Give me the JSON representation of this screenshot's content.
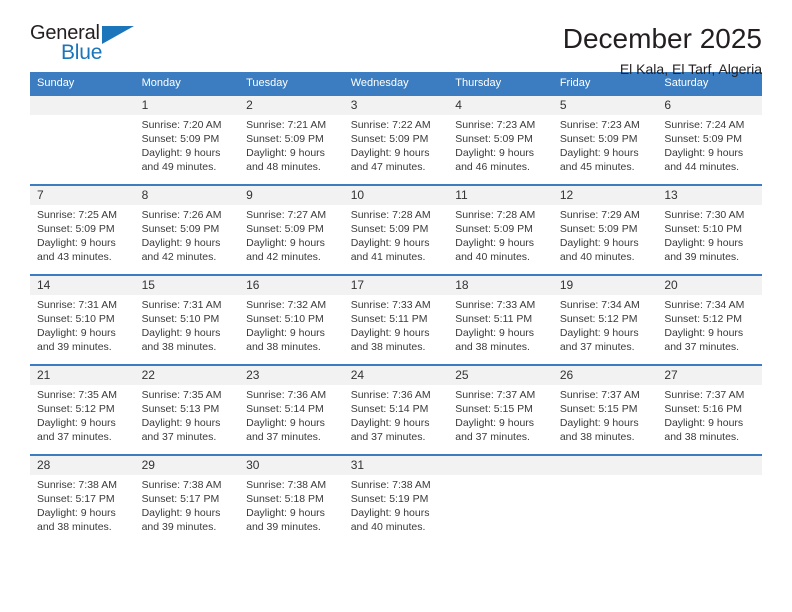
{
  "brand": {
    "name_dark": "General",
    "name_blue": "Blue",
    "accent_color": "#1b75bb"
  },
  "header": {
    "month_year": "December 2025",
    "location": "El Kala, El Tarf, Algeria"
  },
  "theme": {
    "header_row_bg": "#3b7dc0",
    "daynum_bg": "#f2f2f2",
    "text_color": "#333333"
  },
  "weekdays": [
    "Sunday",
    "Monday",
    "Tuesday",
    "Wednesday",
    "Thursday",
    "Friday",
    "Saturday"
  ],
  "labels": {
    "sunrise_prefix": "Sunrise:",
    "sunset_prefix": "Sunset:",
    "daylight_prefix": "Daylight:"
  },
  "weeks": [
    [
      {
        "day": "",
        "empty": true
      },
      {
        "day": "1",
        "line1": "Sunrise: 7:20 AM",
        "line2": "Sunset: 5:09 PM",
        "line3": "Daylight: 9 hours",
        "line4": "and 49 minutes."
      },
      {
        "day": "2",
        "line1": "Sunrise: 7:21 AM",
        "line2": "Sunset: 5:09 PM",
        "line3": "Daylight: 9 hours",
        "line4": "and 48 minutes."
      },
      {
        "day": "3",
        "line1": "Sunrise: 7:22 AM",
        "line2": "Sunset: 5:09 PM",
        "line3": "Daylight: 9 hours",
        "line4": "and 47 minutes."
      },
      {
        "day": "4",
        "line1": "Sunrise: 7:23 AM",
        "line2": "Sunset: 5:09 PM",
        "line3": "Daylight: 9 hours",
        "line4": "and 46 minutes."
      },
      {
        "day": "5",
        "line1": "Sunrise: 7:23 AM",
        "line2": "Sunset: 5:09 PM",
        "line3": "Daylight: 9 hours",
        "line4": "and 45 minutes."
      },
      {
        "day": "6",
        "line1": "Sunrise: 7:24 AM",
        "line2": "Sunset: 5:09 PM",
        "line3": "Daylight: 9 hours",
        "line4": "and 44 minutes."
      }
    ],
    [
      {
        "day": "7",
        "line1": "Sunrise: 7:25 AM",
        "line2": "Sunset: 5:09 PM",
        "line3": "Daylight: 9 hours",
        "line4": "and 43 minutes."
      },
      {
        "day": "8",
        "line1": "Sunrise: 7:26 AM",
        "line2": "Sunset: 5:09 PM",
        "line3": "Daylight: 9 hours",
        "line4": "and 42 minutes."
      },
      {
        "day": "9",
        "line1": "Sunrise: 7:27 AM",
        "line2": "Sunset: 5:09 PM",
        "line3": "Daylight: 9 hours",
        "line4": "and 42 minutes."
      },
      {
        "day": "10",
        "line1": "Sunrise: 7:28 AM",
        "line2": "Sunset: 5:09 PM",
        "line3": "Daylight: 9 hours",
        "line4": "and 41 minutes."
      },
      {
        "day": "11",
        "line1": "Sunrise: 7:28 AM",
        "line2": "Sunset: 5:09 PM",
        "line3": "Daylight: 9 hours",
        "line4": "and 40 minutes."
      },
      {
        "day": "12",
        "line1": "Sunrise: 7:29 AM",
        "line2": "Sunset: 5:09 PM",
        "line3": "Daylight: 9 hours",
        "line4": "and 40 minutes."
      },
      {
        "day": "13",
        "line1": "Sunrise: 7:30 AM",
        "line2": "Sunset: 5:10 PM",
        "line3": "Daylight: 9 hours",
        "line4": "and 39 minutes."
      }
    ],
    [
      {
        "day": "14",
        "line1": "Sunrise: 7:31 AM",
        "line2": "Sunset: 5:10 PM",
        "line3": "Daylight: 9 hours",
        "line4": "and 39 minutes."
      },
      {
        "day": "15",
        "line1": "Sunrise: 7:31 AM",
        "line2": "Sunset: 5:10 PM",
        "line3": "Daylight: 9 hours",
        "line4": "and 38 minutes."
      },
      {
        "day": "16",
        "line1": "Sunrise: 7:32 AM",
        "line2": "Sunset: 5:10 PM",
        "line3": "Daylight: 9 hours",
        "line4": "and 38 minutes."
      },
      {
        "day": "17",
        "line1": "Sunrise: 7:33 AM",
        "line2": "Sunset: 5:11 PM",
        "line3": "Daylight: 9 hours",
        "line4": "and 38 minutes."
      },
      {
        "day": "18",
        "line1": "Sunrise: 7:33 AM",
        "line2": "Sunset: 5:11 PM",
        "line3": "Daylight: 9 hours",
        "line4": "and 38 minutes."
      },
      {
        "day": "19",
        "line1": "Sunrise: 7:34 AM",
        "line2": "Sunset: 5:12 PM",
        "line3": "Daylight: 9 hours",
        "line4": "and 37 minutes."
      },
      {
        "day": "20",
        "line1": "Sunrise: 7:34 AM",
        "line2": "Sunset: 5:12 PM",
        "line3": "Daylight: 9 hours",
        "line4": "and 37 minutes."
      }
    ],
    [
      {
        "day": "21",
        "line1": "Sunrise: 7:35 AM",
        "line2": "Sunset: 5:12 PM",
        "line3": "Daylight: 9 hours",
        "line4": "and 37 minutes."
      },
      {
        "day": "22",
        "line1": "Sunrise: 7:35 AM",
        "line2": "Sunset: 5:13 PM",
        "line3": "Daylight: 9 hours",
        "line4": "and 37 minutes."
      },
      {
        "day": "23",
        "line1": "Sunrise: 7:36 AM",
        "line2": "Sunset: 5:14 PM",
        "line3": "Daylight: 9 hours",
        "line4": "and 37 minutes."
      },
      {
        "day": "24",
        "line1": "Sunrise: 7:36 AM",
        "line2": "Sunset: 5:14 PM",
        "line3": "Daylight: 9 hours",
        "line4": "and 37 minutes."
      },
      {
        "day": "25",
        "line1": "Sunrise: 7:37 AM",
        "line2": "Sunset: 5:15 PM",
        "line3": "Daylight: 9 hours",
        "line4": "and 37 minutes."
      },
      {
        "day": "26",
        "line1": "Sunrise: 7:37 AM",
        "line2": "Sunset: 5:15 PM",
        "line3": "Daylight: 9 hours",
        "line4": "and 38 minutes."
      },
      {
        "day": "27",
        "line1": "Sunrise: 7:37 AM",
        "line2": "Sunset: 5:16 PM",
        "line3": "Daylight: 9 hours",
        "line4": "and 38 minutes."
      }
    ],
    [
      {
        "day": "28",
        "line1": "Sunrise: 7:38 AM",
        "line2": "Sunset: 5:17 PM",
        "line3": "Daylight: 9 hours",
        "line4": "and 38 minutes."
      },
      {
        "day": "29",
        "line1": "Sunrise: 7:38 AM",
        "line2": "Sunset: 5:17 PM",
        "line3": "Daylight: 9 hours",
        "line4": "and 39 minutes."
      },
      {
        "day": "30",
        "line1": "Sunrise: 7:38 AM",
        "line2": "Sunset: 5:18 PM",
        "line3": "Daylight: 9 hours",
        "line4": "and 39 minutes."
      },
      {
        "day": "31",
        "line1": "Sunrise: 7:38 AM",
        "line2": "Sunset: 5:19 PM",
        "line3": "Daylight: 9 hours",
        "line4": "and 40 minutes."
      },
      {
        "day": "",
        "empty": true
      },
      {
        "day": "",
        "empty": true
      },
      {
        "day": "",
        "empty": true
      }
    ]
  ]
}
